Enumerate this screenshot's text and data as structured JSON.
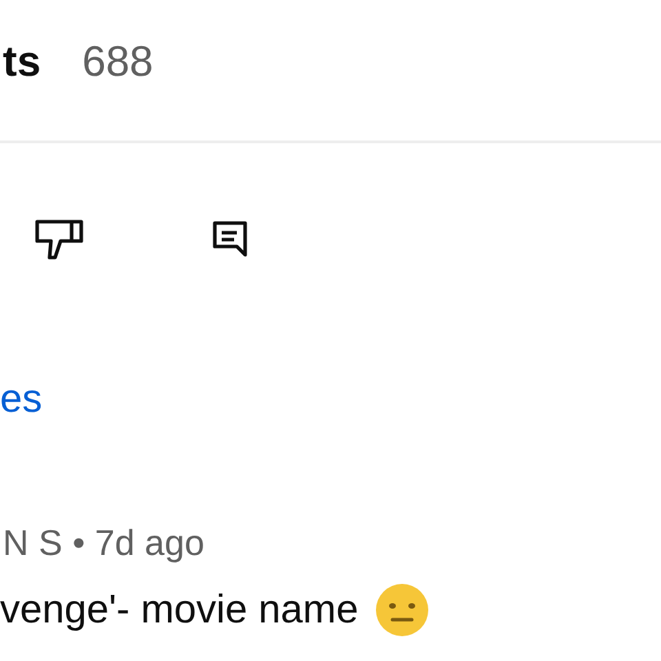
{
  "header": {
    "title": "ts",
    "count": "688"
  },
  "replies_link": "es",
  "comment": {
    "meta": "N S • 7d ago",
    "text": "venge'- movie name"
  }
}
